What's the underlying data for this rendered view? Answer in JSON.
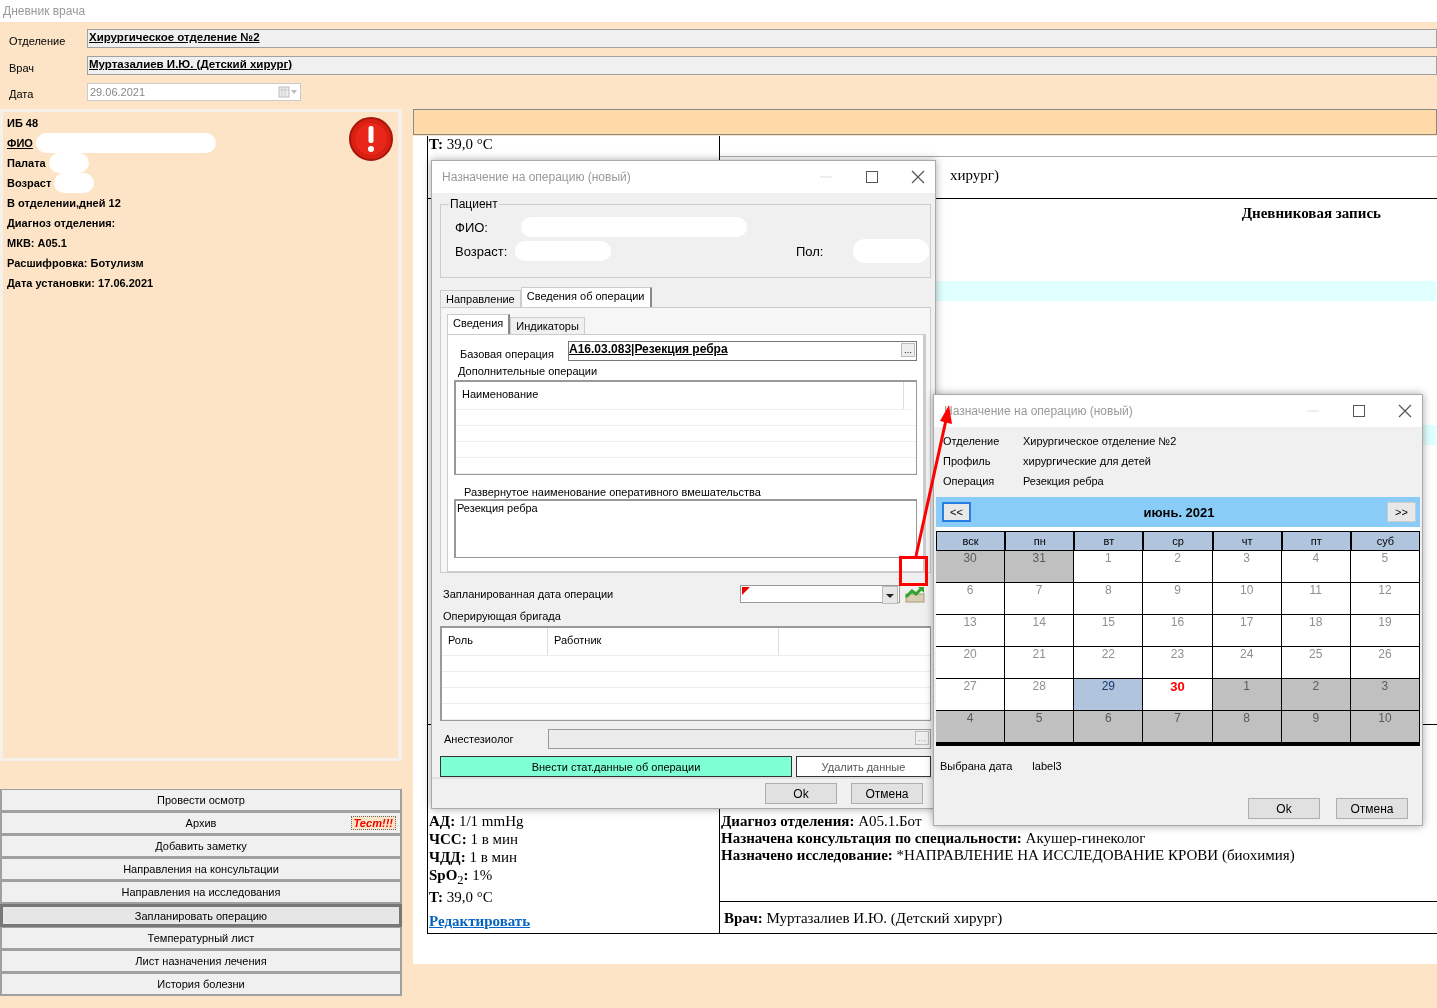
{
  "window": {
    "title": "Дневник врача"
  },
  "header": {
    "fields": [
      {
        "label": "Отделение",
        "value": "Хирургическое отделение №2"
      },
      {
        "label": "Врач",
        "value": "Муртазалиев И.Ю. (Детский хирург)"
      }
    ],
    "date": {
      "label": "Дата",
      "value": "29.06.2021",
      "disabled": true
    }
  },
  "patient_panel": {
    "lines": [
      {
        "text": "ИБ 48",
        "kind": "plain",
        "redacted": false
      },
      {
        "text": "ФИО",
        "kind": "link",
        "redacted": true
      },
      {
        "text": "Палата",
        "kind": "plain",
        "redacted": true
      },
      {
        "text": "Возраст",
        "kind": "plain",
        "redacted": true
      },
      {
        "text": "В отделении,дней 12",
        "kind": "plain",
        "redacted": false
      },
      {
        "text": "Диагноз отделения:",
        "kind": "plain",
        "redacted": false
      },
      {
        "text": "МКВ: A05.1",
        "kind": "plain",
        "redacted": false
      },
      {
        "text": "Расшифровка: Ботулизм",
        "kind": "plain",
        "redacted": false
      },
      {
        "text": "Дата установки: 17.06.2021",
        "kind": "plain",
        "redacted": false
      }
    ]
  },
  "actions": [
    {
      "label": "Провести осмотр",
      "selected": false
    },
    {
      "label": "Архив",
      "selected": false,
      "badge": "Тест!!!"
    },
    {
      "label": "Добавить заметку",
      "selected": false
    },
    {
      "label": "Направления на консультации",
      "selected": false
    },
    {
      "label": "Направления на исследования",
      "selected": false
    },
    {
      "label": "Запланировать операцию",
      "selected": true
    },
    {
      "label": "Температурный лист",
      "selected": false
    },
    {
      "label": "Лист назначения лечения",
      "selected": false
    },
    {
      "label": "История болезни",
      "selected": false
    }
  ],
  "document": {
    "top_left": "**T:** 39,0 °C",
    "top_right": "хирург)",
    "heading": "Дневниковая запись",
    "vitals": [
      "**АД:** 1/1 mmHg",
      "**ЧСС:** 1 в мин",
      "**ЧДД:** 1 в мин",
      "**SpO**$_{2}$**:** 1%",
      "**T:** 39,0 °C"
    ],
    "edit_link": "Редактировать",
    "notes": [
      "**Диагноз отделения:** A05.1.Бот",
      "**Назначена консультация по специальности:** Акушер-гинеколог",
      "**Назначено исследование:** *НАПРАВЛЕНИЕ НА ИССЛЕДОВАНИЕ КРОВИ (биохимия)"
    ],
    "doctor": "**Врач:** Муртазалиев И.Ю. (Детский хирург)"
  },
  "operation_dialog": {
    "title": "Назначение на операцию (новый)",
    "patient": {
      "title": "Пациент",
      "fio_label": "ФИО:",
      "age_label": "Возраст:",
      "sex_label": "Пол:"
    },
    "tabs": [
      {
        "label": "Направление",
        "selected": false
      },
      {
        "label": "Сведения об операции",
        "selected": true
      }
    ],
    "subtabs": [
      {
        "label": "Сведения",
        "selected": true
      },
      {
        "label": "Индикаторы",
        "selected": false
      }
    ],
    "base_operation": {
      "label": "Базовая операция",
      "value": "A16.03.083|Резекция ребра"
    },
    "extra_operations": {
      "title": "Дополнительные операции",
      "columns": [
        "Наименование"
      ]
    },
    "full_name": {
      "label": "Развернутое наименование оперативного вмешательства",
      "value": "Резекция ребра"
    },
    "planned_date": {
      "label": "Запланированная дата операции",
      "invalid": true
    },
    "team": {
      "title": "Оперирующая бригада",
      "columns": [
        "Роль",
        "Работник"
      ]
    },
    "anesthesiologist": {
      "label": "Анестезиолог"
    },
    "stat_button": "Внести стат.данные об операции",
    "delete_button": "Удалить данные",
    "buttons": [
      "Ok",
      "Отмена"
    ]
  },
  "calendar_dialog": {
    "title": "Назначение на операцию (новый)",
    "info": [
      {
        "label": "Отделение",
        "value": "Хирургическое отделение №2"
      },
      {
        "label": "Профиль",
        "value": "хирургические для детей"
      },
      {
        "label": "Операция",
        "value": "Резекция ребра"
      }
    ],
    "calendar": {
      "month": "июнь. 2021",
      "prev": "<<",
      "next": ">>",
      "weekdays": [
        "вск",
        "пн",
        "вт",
        "ср",
        "чт",
        "пт",
        "суб"
      ],
      "weeks": [
        [
          {
            "day": "30",
            "kind": "outside"
          },
          {
            "day": "31",
            "kind": "outside"
          },
          {
            "day": "1",
            "kind": "day"
          },
          {
            "day": "2",
            "kind": "day"
          },
          {
            "day": "3",
            "kind": "day"
          },
          {
            "day": "4",
            "kind": "day"
          },
          {
            "day": "5",
            "kind": "day"
          }
        ],
        [
          {
            "day": "6",
            "kind": "day"
          },
          {
            "day": "7",
            "kind": "day"
          },
          {
            "day": "8",
            "kind": "day"
          },
          {
            "day": "9",
            "kind": "day"
          },
          {
            "day": "10",
            "kind": "day"
          },
          {
            "day": "11",
            "kind": "day"
          },
          {
            "day": "12",
            "kind": "day"
          }
        ],
        [
          {
            "day": "13",
            "kind": "day"
          },
          {
            "day": "14",
            "kind": "day"
          },
          {
            "day": "15",
            "kind": "day"
          },
          {
            "day": "16",
            "kind": "day"
          },
          {
            "day": "17",
            "kind": "day"
          },
          {
            "day": "18",
            "kind": "day"
          },
          {
            "day": "19",
            "kind": "day"
          }
        ],
        [
          {
            "day": "20",
            "kind": "day"
          },
          {
            "day": "21",
            "kind": "day"
          },
          {
            "day": "22",
            "kind": "day"
          },
          {
            "day": "23",
            "kind": "day"
          },
          {
            "day": "24",
            "kind": "day"
          },
          {
            "day": "25",
            "kind": "day"
          },
          {
            "day": "26",
            "kind": "day"
          }
        ],
        [
          {
            "day": "27",
            "kind": "day"
          },
          {
            "day": "28",
            "kind": "day"
          },
          {
            "day": "29",
            "kind": "selected"
          },
          {
            "day": "30",
            "kind": "today"
          },
          {
            "day": "1",
            "kind": "outside"
          },
          {
            "day": "2",
            "kind": "outside"
          },
          {
            "day": "3",
            "kind": "outside"
          }
        ],
        [
          {
            "day": "4",
            "kind": "outside"
          },
          {
            "day": "5",
            "kind": "outside"
          },
          {
            "day": "6",
            "kind": "outside"
          },
          {
            "day": "7",
            "kind": "outside"
          },
          {
            "day": "8",
            "kind": "outside"
          },
          {
            "day": "9",
            "kind": "outside"
          },
          {
            "day": "10",
            "kind": "outside"
          }
        ]
      ]
    },
    "selection": {
      "label": "Выбрана дата",
      "value": "label3"
    },
    "buttons": [
      "Ok",
      "Отмена"
    ]
  }
}
